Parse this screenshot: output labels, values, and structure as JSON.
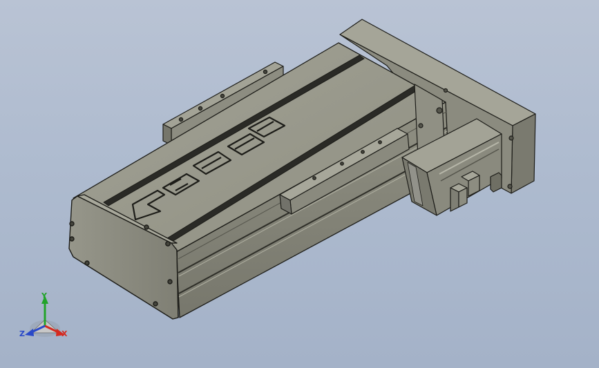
{
  "viewport": {
    "background_top": "#b9c3d4",
    "background_bottom": "#a4b2c8"
  },
  "model": {
    "body_color": "#8f8f82",
    "top_color": "#9a9a8c",
    "dark_color": "#6f6f64",
    "slot_color": "#2a2a26",
    "edge_color": "#1c1c18",
    "logo_letters": [
      "2",
      "H",
      "T",
      "H"
    ]
  },
  "triad": {
    "x_label": "X",
    "y_label": "Y",
    "z_label": "Z",
    "x_color": "#d52a1f",
    "y_color": "#22a32a",
    "z_color": "#2a49c8"
  }
}
